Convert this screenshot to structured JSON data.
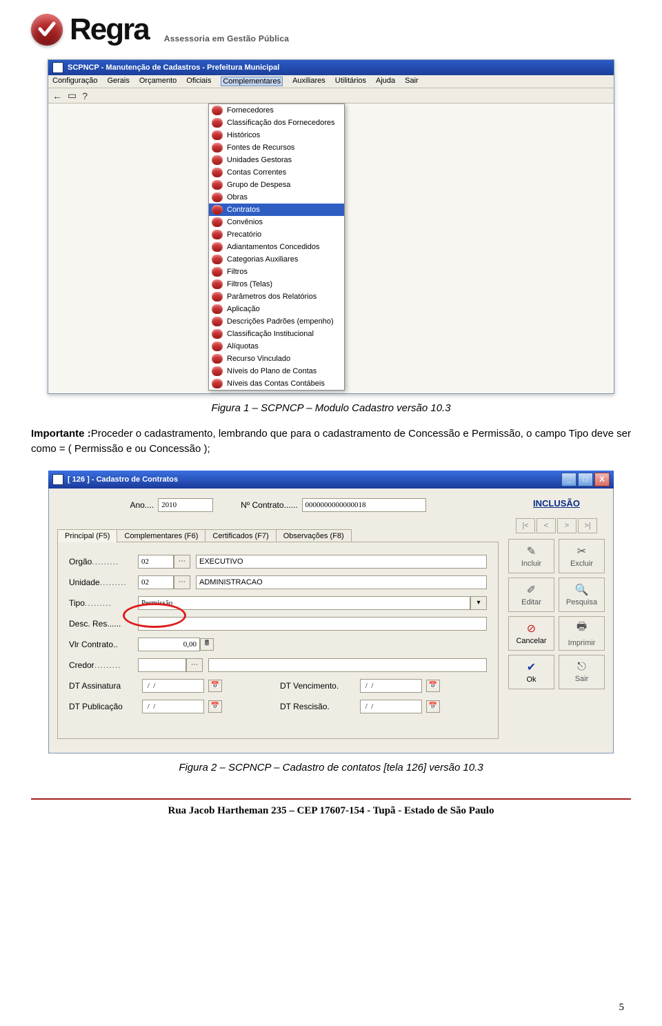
{
  "logo": {
    "name": "Regra",
    "subtitle": "Assessoria em Gestão Pública"
  },
  "win1": {
    "title": "SCPNCP - Manutenção de Cadastros - Prefeitura Municipal",
    "menus": [
      "Configuração",
      "Gerais",
      "Orçamento",
      "Oficiais",
      "Complementares",
      "Auxiliares",
      "Utilitários",
      "Ajuda",
      "Sair"
    ],
    "active_menu_index": 4,
    "dropdown": {
      "highlight_index": 8,
      "items": [
        "Fornecedores",
        "Classificação dos Fornecedores",
        "Históricos",
        "Fontes de Recursos",
        "Unidades Gestoras",
        "Contas Correntes",
        "Grupo de Despesa",
        "Obras",
        "Contratos",
        "Convênios",
        "Precatório",
        "Adiantamentos Concedidos",
        "Categorias Auxiliares",
        "Filtros",
        "Filtros (Telas)",
        "Parâmetros dos Relatórios",
        "Aplicação",
        "Descrições Padrões (empenho)",
        "Classificação Institucional",
        "Alíquotas",
        "Recurso Vinculado",
        "Níveis do Plano de Contas",
        "Níveis das Contas Contábeis"
      ]
    }
  },
  "caption1": "Figura 1 – SCPNCP – Modulo Cadastro versão 10.3",
  "para": {
    "lead": "Importante :",
    "rest": "Proceder o cadastramento, lembrando que para o cadastramento de Concessão e Permissão, o campo Tipo deve ser como = ( Permissão e ou Concessão );"
  },
  "dlg": {
    "title": "[ 126 ] - Cadastro de Contratos",
    "ano_label": "Ano....",
    "ano_value": "2010",
    "num_label": "Nº Contrato......",
    "num_value": "0000000000000018",
    "tabs": [
      "Principal (F5)",
      "Complementares (F6)",
      "Certificados (F7)",
      "Observações (F8)"
    ],
    "active_tab": 0,
    "fields": {
      "orgao_label": "Orgão",
      "orgao_code": "02",
      "orgao_text": "EXECUTIVO",
      "unidade_label": "Unidade",
      "unidade_code": "02",
      "unidade_text": "ADMINISTRACAO",
      "tipo_label": "Tipo",
      "tipo_value": "Permissão",
      "desc_label": "Desc. Res",
      "desc_value": "",
      "vlr_label": "Vlr Contrato..",
      "vlr_value": "0,00",
      "credor_label": "Credor",
      "credor_value": "",
      "dt_ass_label": "DT Assinatura",
      "dt_ass_value": " /  / ",
      "dt_pub_label": "DT Publicação",
      "dt_pub_value": " /  / ",
      "dt_venc_label": "DT Vencimento.",
      "dt_venc_value": " /  / ",
      "dt_resc_label": "DT Rescisão.",
      "dt_resc_value": " /  / "
    },
    "side": {
      "title": "INCLUSÃO",
      "nav": [
        "|<",
        "<",
        ">",
        ">|"
      ],
      "buttons": [
        {
          "label": "Incluir",
          "icon": "✎",
          "enabled": false
        },
        {
          "label": "Excluir",
          "icon": "✂",
          "enabled": false
        },
        {
          "label": "Editar",
          "icon": "✐",
          "enabled": false
        },
        {
          "label": "Pesquisa",
          "icon": "🔍",
          "enabled": false
        },
        {
          "label": "Cancelar",
          "icon": "⊘",
          "enabled": true,
          "cls": "cancel"
        },
        {
          "label": "Imprimir",
          "icon": "🖶",
          "enabled": false
        },
        {
          "label": "Ok",
          "icon": "✔",
          "enabled": true,
          "cls": "ok"
        },
        {
          "label": "Sair",
          "icon": "⎋",
          "enabled": false
        }
      ]
    }
  },
  "caption2": "Figura 2 – SCPNCP – Cadastro de contatos [tela 126] versão 10.3",
  "footer": "Rua Jacob Hartheman 235 – CEP 17607-154 - Tupã - Estado de São Paulo",
  "page_number": "5"
}
